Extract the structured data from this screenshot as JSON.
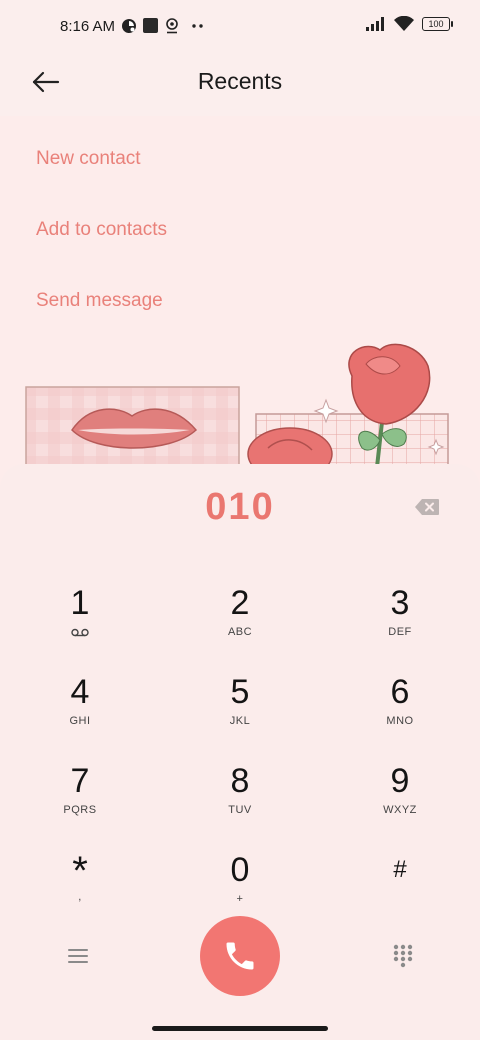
{
  "status_bar": {
    "time": "8:16 AM",
    "battery": "100",
    "icons": [
      "clock-badge-icon",
      "square-notification-icon",
      "location-pin-icon",
      "more-dots-icon",
      "signal-icon",
      "wifi-icon",
      "battery-icon"
    ]
  },
  "header": {
    "title": "Recents",
    "back_icon": "back-arrow-icon"
  },
  "menu": {
    "new_contact": "New contact",
    "add_to_contacts": "Add to contacts",
    "send_message": "Send message"
  },
  "dialpad": {
    "number": "010",
    "keys": [
      {
        "digit": "1",
        "sub": ""
      },
      {
        "digit": "2",
        "sub": "ABC"
      },
      {
        "digit": "3",
        "sub": "DEF"
      },
      {
        "digit": "4",
        "sub": "GHI"
      },
      {
        "digit": "5",
        "sub": "JKL"
      },
      {
        "digit": "6",
        "sub": "MNO"
      },
      {
        "digit": "7",
        "sub": "PQRS"
      },
      {
        "digit": "8",
        "sub": "TUV"
      },
      {
        "digit": "9",
        "sub": "WXYZ"
      },
      {
        "digit": "*",
        "sub": ","
      },
      {
        "digit": "0",
        "sub": "+"
      },
      {
        "digit": "#",
        "sub": ""
      }
    ],
    "icons": {
      "voicemail": "voicemail-icon",
      "backspace": "backspace-icon",
      "call": "phone-icon",
      "menu": "menu-lines-icon",
      "dialpad_toggle": "dialpad-grid-icon"
    }
  },
  "colors": {
    "accent": "#e9817a",
    "number": "#ea7770",
    "call_button": "#f27672",
    "background": "#fdeceb"
  }
}
